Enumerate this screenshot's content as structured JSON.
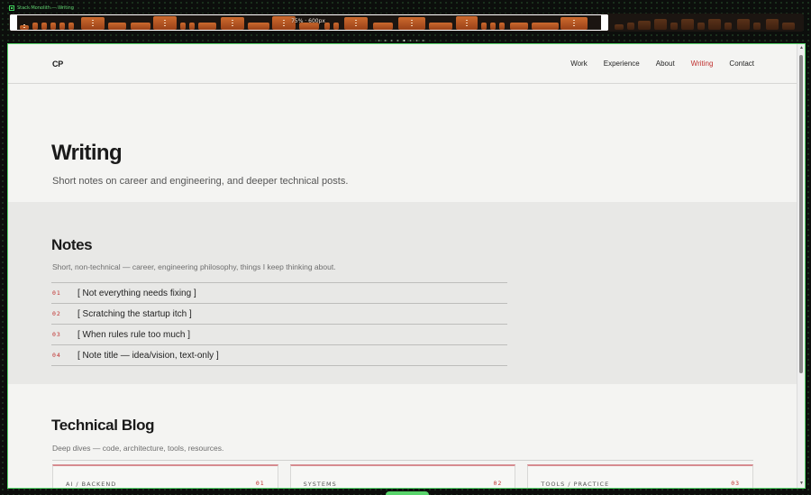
{
  "app": {
    "title": "Stack Monolith — Writing",
    "accent": "#3fcf5a"
  },
  "preview_strip": {
    "viewport_label": "75% · 600px",
    "pages_total": 8,
    "page_current": 5
  },
  "site": {
    "logo": "CP",
    "nav": [
      {
        "label": "Work",
        "active": false
      },
      {
        "label": "Experience",
        "active": false
      },
      {
        "label": "About",
        "active": false
      },
      {
        "label": "Writing",
        "active": true
      },
      {
        "label": "Contact",
        "active": false
      }
    ],
    "hero": {
      "title": "Writing",
      "subtitle": "Short notes on career and engineering, and deeper technical posts."
    },
    "notes": {
      "title": "Notes",
      "subtitle": "Short, non-technical — career, engineering philosophy, things I keep thinking about.",
      "items": [
        {
          "num": "01",
          "title": "[ Not everything needs fixing ]"
        },
        {
          "num": "02",
          "title": "[ Scratching the startup itch ]"
        },
        {
          "num": "03",
          "title": "[ When rules rule too much ]"
        },
        {
          "num": "04",
          "title": "[ Note title — idea/vision, text-only ]"
        }
      ]
    },
    "blog": {
      "title": "Technical Blog",
      "subtitle": "Deep dives — code, architecture, tools, resources.",
      "cards": [
        {
          "category": "AI / BACKEND",
          "index": "01"
        },
        {
          "category": "SYSTEMS",
          "index": "02"
        },
        {
          "category": "TOOLS / PRACTICE",
          "index": "03"
        }
      ]
    },
    "colors": {
      "accent": "#c0312f",
      "background": "#f4f4f2",
      "notes_bg": "#e8e8e6"
    }
  }
}
